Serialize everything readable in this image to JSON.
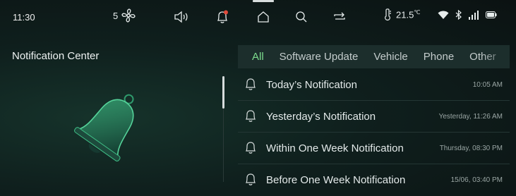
{
  "status": {
    "time": "11:30",
    "fan_level": "5",
    "temperature": "21.5",
    "temperature_unit": "℃"
  },
  "icons": {
    "fan": "fan-icon",
    "volume": "volume-icon",
    "notification": "notification-bell-alert-icon",
    "home": "home-icon",
    "search": "search-icon",
    "repeat": "repeat-icon",
    "thermometer": "thermometer-icon",
    "wifi": "wifi-icon",
    "bluetooth": "bluetooth-icon",
    "signal": "signal-icon",
    "battery": "battery-icon"
  },
  "panel": {
    "title": "Notification Center"
  },
  "tabs": [
    {
      "label": "All",
      "active": true
    },
    {
      "label": "Software Update"
    },
    {
      "label": "Vehicle"
    },
    {
      "label": "Phone"
    },
    {
      "label": "Other"
    }
  ],
  "notifications": [
    {
      "label": "Today’s Notification",
      "time": "10:05 AM"
    },
    {
      "label": "Yesterday’s Notification",
      "time": "Yesterday, 11:26 AM"
    },
    {
      "label": "Within One Week Notification",
      "time": "Thursday, 08:30 PM"
    },
    {
      "label": "Before One Week Notification",
      "time": "15/06, 03:40 PM"
    }
  ],
  "colors": {
    "accent": "#7ddd8e",
    "alert_dot": "#e24b3b",
    "background": "#0f1f1d"
  }
}
